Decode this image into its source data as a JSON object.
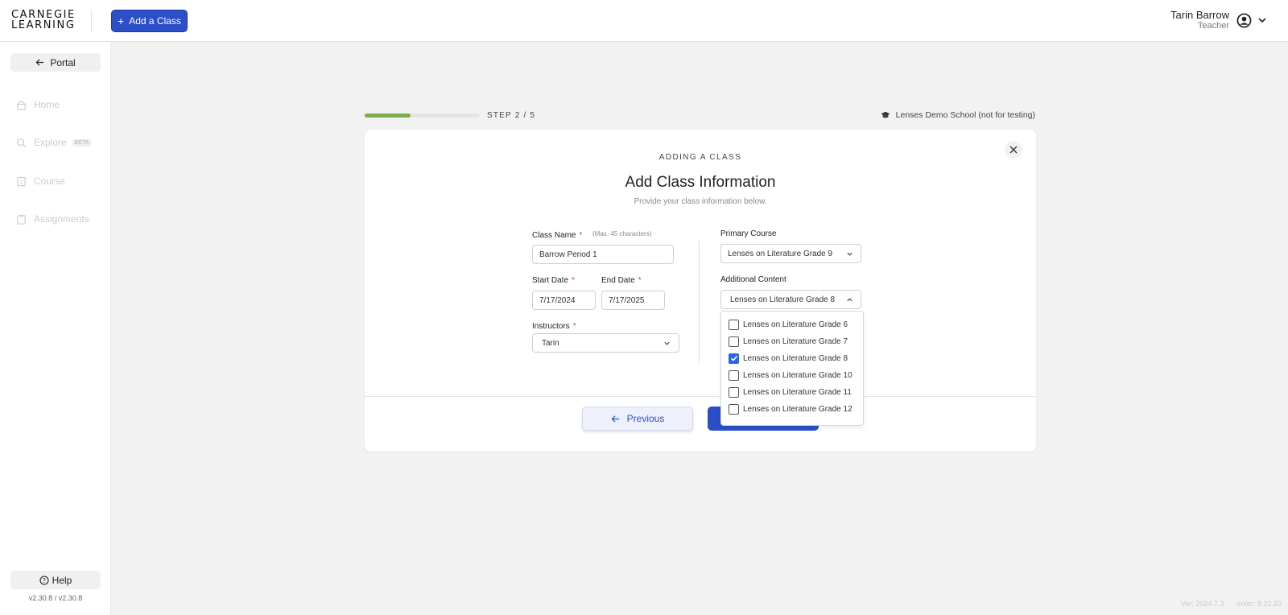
{
  "header": {
    "logo_line1": "CARNEGIE",
    "logo_line2": "LEARNING",
    "add_class_label": "Add a Class",
    "user_name": "Tarin Barrow",
    "user_role": "Teacher"
  },
  "sidebar": {
    "portal_label": "Portal",
    "items": [
      {
        "label": "Home",
        "icon": "home-icon"
      },
      {
        "label": "Explore",
        "icon": "search-icon",
        "badge": "BETA"
      },
      {
        "label": "Course",
        "icon": "course-icon"
      },
      {
        "label": "Assignments",
        "icon": "assignments-icon"
      }
    ],
    "help_label": "Help",
    "version": "v2.30.8 / v2.30.8"
  },
  "footer": {
    "ver": "Ver: 2024.7.3",
    "mver": "mVer: 8.21.23"
  },
  "wizard": {
    "step_label": "STEP 2 / 5",
    "progress_fraction": 0.4,
    "school_name": "Lenses Demo School (not for testing)",
    "eyebrow": "ADDING A CLASS",
    "title": "Add Class Information",
    "subtitle": "Provide your class information below."
  },
  "form": {
    "class_name_label": "Class Name",
    "class_name_hint": "(Max. 45 characters)",
    "class_name_value": "Barrow Period 1",
    "start_date_label": "Start Date",
    "start_date_value": "7/17/2024",
    "end_date_label": "End Date",
    "end_date_value": "7/17/2025",
    "instructors_label": "Instructors",
    "instructors_value": "Tarin",
    "required_mark": "*",
    "primary_course_label": "Primary Course",
    "primary_course_value": "Lenses on Literature Grade 9",
    "additional_content_label": "Additional Content",
    "additional_content_value": "Lenses on Literature Grade 8",
    "additional_options": [
      {
        "label": "Lenses on Literature Grade 6",
        "checked": false
      },
      {
        "label": "Lenses on Literature Grade 7",
        "checked": false
      },
      {
        "label": "Lenses on Literature Grade 8",
        "checked": true
      },
      {
        "label": "Lenses on Literature Grade 10",
        "checked": false
      },
      {
        "label": "Lenses on Literature Grade 11",
        "checked": false
      },
      {
        "label": "Lenses on Literature Grade 12",
        "checked": false
      }
    ]
  },
  "actions": {
    "previous_label": "Previous",
    "next_label": ""
  },
  "colors": {
    "primary": "#2b4fc9",
    "progress": "#7aad4a",
    "required": "#e0413c",
    "checkbox_checked": "#2b68e0"
  }
}
